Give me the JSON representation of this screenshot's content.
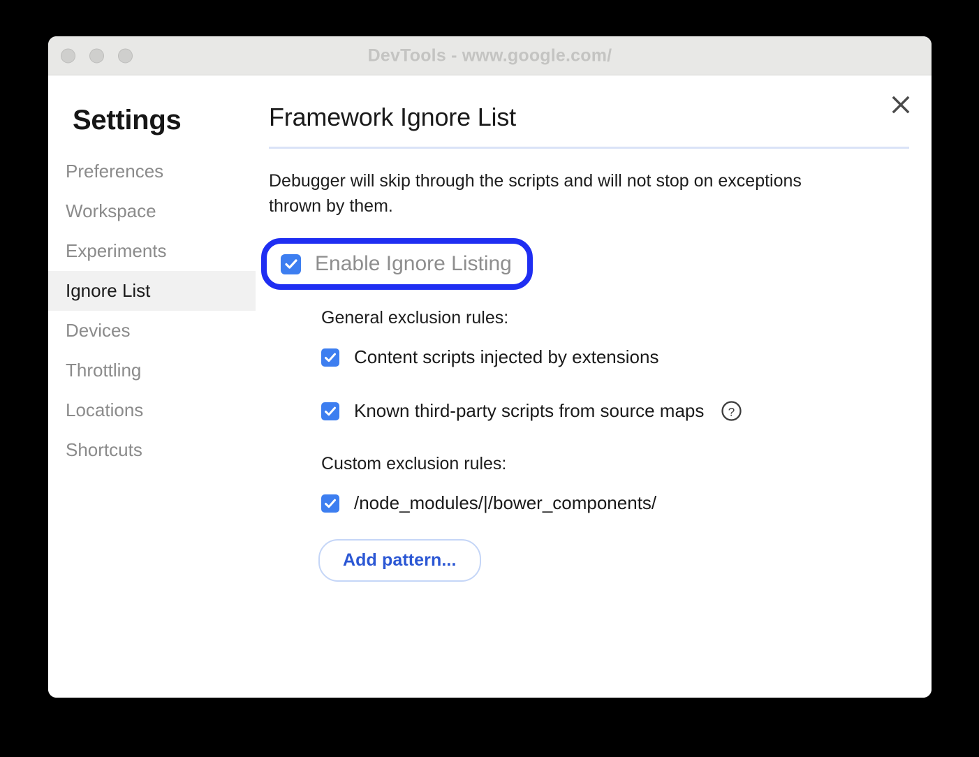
{
  "window": {
    "title": "DevTools - www.google.com/",
    "traffic_lights": [
      "close-button",
      "minimize-button",
      "maximize-button"
    ]
  },
  "sidebar": {
    "title": "Settings",
    "items": [
      {
        "label": "Preferences",
        "selected": false
      },
      {
        "label": "Workspace",
        "selected": false
      },
      {
        "label": "Experiments",
        "selected": false
      },
      {
        "label": "Ignore List",
        "selected": true
      },
      {
        "label": "Devices",
        "selected": false
      },
      {
        "label": "Throttling",
        "selected": false
      },
      {
        "label": "Locations",
        "selected": false
      },
      {
        "label": "Shortcuts",
        "selected": false
      }
    ]
  },
  "panel": {
    "title": "Framework Ignore List",
    "description": "Debugger will skip through the scripts and will not stop on exceptions thrown by them.",
    "close_icon": "close-icon",
    "enable_toggle": {
      "label": "Enable Ignore Listing",
      "checked": true,
      "highlighted": true
    },
    "general_rules": {
      "heading": "General exclusion rules:",
      "items": [
        {
          "label": "Content scripts injected by extensions",
          "checked": true,
          "help": false
        },
        {
          "label": "Known third-party scripts from source maps",
          "checked": true,
          "help": true,
          "help_icon": "help-circle-icon"
        }
      ]
    },
    "custom_rules": {
      "heading": "Custom exclusion rules:",
      "items": [
        {
          "label": "/node_modules/|/bower_components/",
          "checked": true
        }
      ]
    },
    "add_pattern_label": "Add pattern..."
  },
  "colors": {
    "accent_checkbox": "#3d7ef0",
    "annotation_highlight": "#1f2ef2",
    "divider": "#dae3f7",
    "button_text": "#2b57d4",
    "selected_nav_bg": "#f1f1f1",
    "titlebar_bg": "#e8e8e6"
  }
}
